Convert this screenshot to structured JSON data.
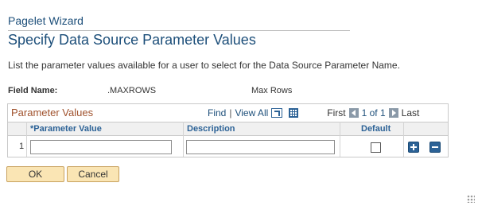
{
  "wizard": {
    "label": "Pagelet Wizard"
  },
  "page": {
    "title": "Specify Data Source Parameter Values",
    "instructions": "List the parameter values available for a user to select for the Data Source Parameter Name."
  },
  "field": {
    "label": "Field Name:",
    "value": ".MAXROWS",
    "description": "Max Rows"
  },
  "grid": {
    "title": "Parameter Values",
    "nav": {
      "find": "Find",
      "separator": "|",
      "view_all": "View All",
      "first": "First",
      "count": "1 of 1",
      "last": "Last"
    },
    "columns": {
      "value": "*Parameter Value",
      "description": "Description",
      "default": "Default"
    },
    "rows": [
      {
        "num": "1",
        "value": "",
        "description": "",
        "default": false
      }
    ],
    "icons": [
      "zoom-icon",
      "download-grid-icon",
      "prev-icon",
      "next-icon",
      "add-row-icon",
      "delete-row-icon"
    ]
  },
  "buttons": {
    "ok": "OK",
    "cancel": "Cancel"
  }
}
